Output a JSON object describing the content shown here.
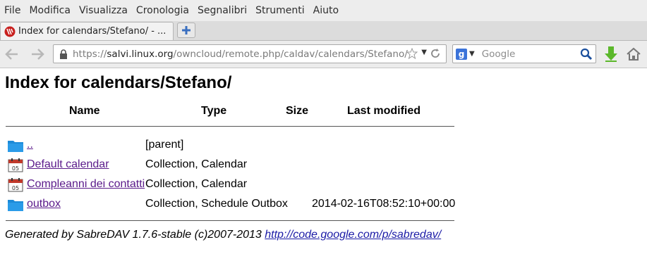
{
  "menu": [
    {
      "label": "File"
    },
    {
      "label": "Modifica"
    },
    {
      "label": "Visualizza"
    },
    {
      "label": "Cronologia"
    },
    {
      "label": "Segnalibri"
    },
    {
      "label": "Strumenti"
    },
    {
      "label": "Aiuto"
    }
  ],
  "tab": {
    "title": "Index for calendars/Stefano/ - ..."
  },
  "nav": {
    "url_prefix": "https://",
    "url_host": "salvi.linux.org",
    "url_path": "/owncloud/remote.php/caldav/calendars/Stefano/",
    "search_placeholder": "Google"
  },
  "page": {
    "heading": "Index for calendars/Stefano/",
    "columns": {
      "name": "Name",
      "type": "Type",
      "size": "Size",
      "modified": "Last modified"
    },
    "rows": [
      {
        "name": "..",
        "type": "[parent]",
        "modified": "",
        "icon": "folder-icon"
      },
      {
        "name": "Default calendar",
        "type": "Collection, Calendar",
        "modified": "",
        "icon": "calendar-icon"
      },
      {
        "name": "Compleanni dei contatti",
        "type": "Collection, Calendar",
        "modified": "",
        "icon": "calendar-icon"
      },
      {
        "name": "outbox",
        "type": "Collection, Schedule Outbox",
        "modified": "2014-02-16T08:52:10+00:00",
        "icon": "folder-icon"
      }
    ],
    "footer_text": "Generated by SabreDAV 1.7.6-stable (c)2007-2013 ",
    "footer_link": "http://code.google.com/p/sabredav/"
  },
  "colors": {
    "link_visited": "#5a1a8a",
    "link": "#1a1aa6",
    "folder": "#1c8ad8"
  }
}
